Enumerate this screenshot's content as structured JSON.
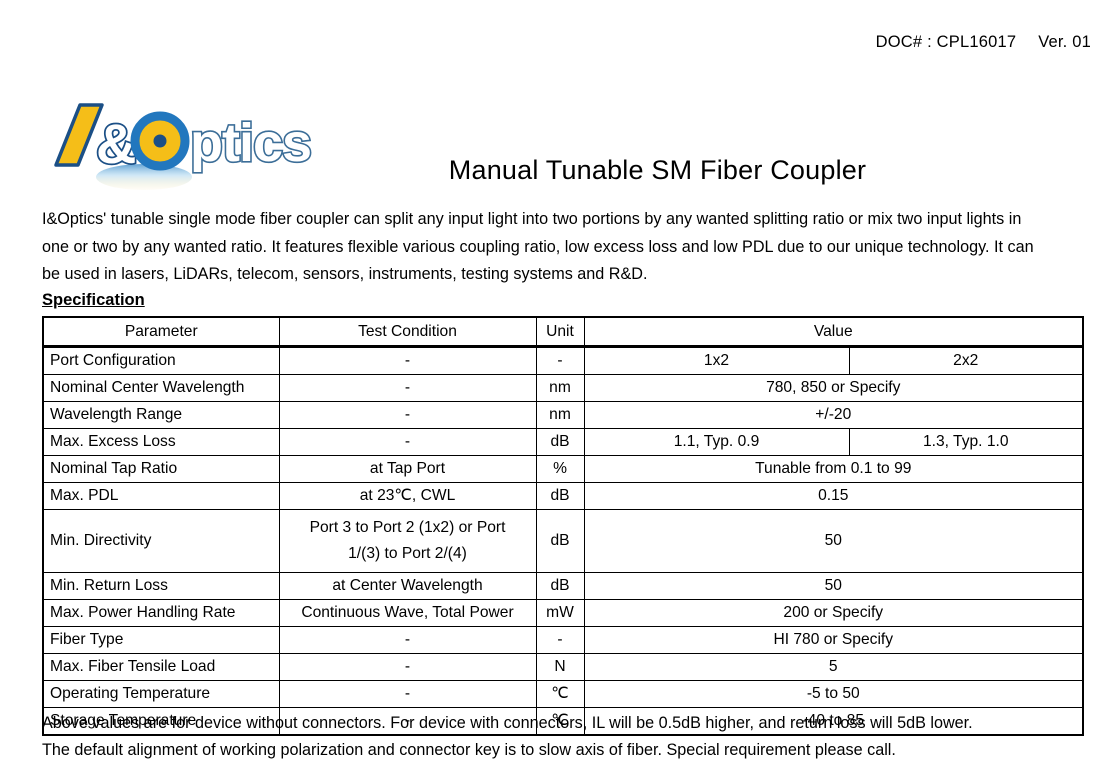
{
  "doc": {
    "doc_number_label": "DOC# : CPL16017",
    "version_label": "Ver. 01",
    "title": "Manual Tunable SM Fiber Coupler",
    "spec_heading": "Specification"
  },
  "logo": {
    "text": "I&Optics",
    "part_i": "I",
    "part_amp": "&",
    "part_o": "O",
    "part_ptics": "ptics",
    "blue": "#1F6FB5",
    "dark_blue": "#1B4F86",
    "yellow": "#F5BE18"
  },
  "intro": {
    "paragraph": "I&Optics' tunable single mode fiber coupler can split any input light into two portions by any wanted splitting ratio or mix two input lights in one or two by any wanted ratio. It features flexible various coupling ratio, low excess loss and low PDL due to our unique technology. It can be used in lasers, LiDARs, telecom, sensors, instruments, testing systems and R&D."
  },
  "table": {
    "headers": {
      "parameter": "Parameter",
      "test_condition": "Test Condition",
      "unit": "Unit",
      "value": "Value"
    },
    "rows": [
      {
        "parameter": "Port Configuration",
        "test_condition": "-",
        "unit": "-",
        "value_a": "1x2",
        "value_b": "2x2",
        "split": true
      },
      {
        "parameter": "Nominal Center Wavelength",
        "test_condition": "-",
        "unit": "nm",
        "value": "780, 850 or Specify",
        "split": false
      },
      {
        "parameter": "Wavelength Range",
        "test_condition": "-",
        "unit": "nm",
        "value": "+/-20",
        "split": false
      },
      {
        "parameter": "Max. Excess Loss",
        "test_condition": "-",
        "unit": "dB",
        "value_a": "1.1, Typ. 0.9",
        "value_b": "1.3, Typ. 1.0",
        "split": true
      },
      {
        "parameter": "Nominal Tap Ratio",
        "test_condition": "at Tap Port",
        "unit": "%",
        "value": "Tunable from 0.1 to 99",
        "split": false
      },
      {
        "parameter": "Max. PDL",
        "test_condition": "at 23℃, CWL",
        "unit": "dB",
        "value": "0.15",
        "split": false
      },
      {
        "parameter": "Min. Directivity",
        "test_condition_line1": "Port 3 to Port 2 (1x2) or Port",
        "test_condition_line2": "1/(3) to Port 2/(4)",
        "unit": "dB",
        "value": "50",
        "split": false,
        "tall": true
      },
      {
        "parameter": "Min. Return Loss",
        "test_condition": "at Center Wavelength",
        "unit": "dB",
        "value": "50",
        "split": false
      },
      {
        "parameter": "Max. Power Handling Rate",
        "test_condition": "Continuous Wave, Total Power",
        "unit": "mW",
        "value": "200 or Specify",
        "split": false
      },
      {
        "parameter": "Fiber Type",
        "test_condition": "-",
        "unit": "-",
        "value": "HI 780 or Specify",
        "split": false
      },
      {
        "parameter": "Max. Fiber Tensile Load",
        "test_condition": "-",
        "unit": "N",
        "value": "5",
        "split": false
      },
      {
        "parameter": "Operating Temperature",
        "test_condition": "-",
        "unit": "℃",
        "value": "-5 to 50",
        "split": false
      },
      {
        "parameter": "Storage Temperature",
        "test_condition": "-",
        "unit": "℃",
        "value": "-40 to 85",
        "split": false
      }
    ]
  },
  "notes": {
    "line1": "Above values are for device without connectors. For device with connectors, IL will be 0.5dB higher,  and return loss will 5dB lower.",
    "line2": "The default alignment of working polarization and connector key is to slow axis of fiber. Special requirement please call."
  }
}
